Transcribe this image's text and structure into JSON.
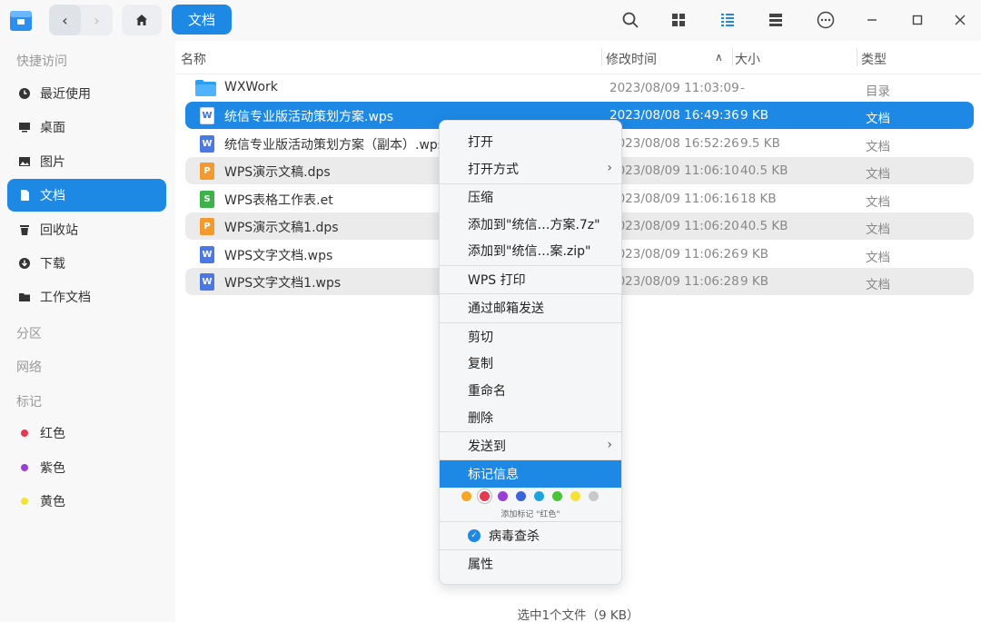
{
  "titlebar": {
    "breadcrumb": "文档",
    "icons": [
      "search-icon",
      "icon-view-icon",
      "list-view-icon",
      "detail-view-icon",
      "more-menu-icon",
      "minimize-icon",
      "maximize-icon",
      "close-icon"
    ]
  },
  "sidebar": {
    "quick_access_label": "快捷访问",
    "items": [
      {
        "label": "最近使用",
        "icon": "clock-icon"
      },
      {
        "label": "桌面",
        "icon": "desktop-icon"
      },
      {
        "label": "图片",
        "icon": "image-icon"
      },
      {
        "label": "文档",
        "icon": "document-icon"
      },
      {
        "label": "回收站",
        "icon": "trash-icon"
      },
      {
        "label": "下载",
        "icon": "download-icon"
      },
      {
        "label": "工作文档",
        "icon": "folder-icon"
      }
    ],
    "partition_label": "分区",
    "network_label": "网络",
    "tags_label": "标记",
    "tags": [
      {
        "label": "红色",
        "color": "#e53950"
      },
      {
        "label": "紫色",
        "color": "#9a3fd6"
      },
      {
        "label": "黄色",
        "color": "#f4e23a"
      }
    ]
  },
  "columns": {
    "name": "名称",
    "mtime": "修改时间",
    "size": "大小",
    "type": "类型"
  },
  "files": [
    {
      "name": "WXWork",
      "mtime": "2023/08/09 11:03:09",
      "size": "-",
      "type": "目录",
      "kind": "folder"
    },
    {
      "name": "统信专业版活动策划方案.wps",
      "mtime": "2023/08/08 16:49:36",
      "size": "9 KB",
      "type": "文档",
      "kind": "wps"
    },
    {
      "name": "统信专业版活动策划方案（副本）.wps",
      "mtime": "2023/08/08 16:52:26",
      "size": "9.5 KB",
      "type": "文档",
      "kind": "wps"
    },
    {
      "name": "WPS演示文稿.dps",
      "mtime": "2023/08/09 11:06:10",
      "size": "40.5 KB",
      "type": "文档",
      "kind": "dps"
    },
    {
      "name": "WPS表格工作表.et",
      "mtime": "2023/08/09 11:06:16",
      "size": "18 KB",
      "type": "文档",
      "kind": "et"
    },
    {
      "name": "WPS演示文稿1.dps",
      "mtime": "2023/08/09 11:06:20",
      "size": "40.5 KB",
      "type": "文档",
      "kind": "dps"
    },
    {
      "name": "WPS文字文档.wps",
      "mtime": "2023/08/09 11:06:26",
      "size": "9 KB",
      "type": "文档",
      "kind": "wps"
    },
    {
      "name": "WPS文字文档1.wps",
      "mtime": "2023/08/09 11:06:28",
      "size": "9 KB",
      "type": "文档",
      "kind": "wps"
    }
  ],
  "file_icon_letters": {
    "wps": "W",
    "dps": "P",
    "et": "S"
  },
  "status": "选中1个文件（9 KB）",
  "context_menu": {
    "open": "打开",
    "open_with": "打开方式",
    "compress": "压缩",
    "add_7z": "添加到\"统信…方案.7z\"",
    "add_zip": "添加到\"统信…案.zip\"",
    "wps_print": "WPS 打印",
    "email_send": "通过邮箱发送",
    "cut": "剪切",
    "copy": "复制",
    "rename": "重命名",
    "delete": "删除",
    "send_to": "发送到",
    "tag_info": "标记信息",
    "tag_colors": [
      "#f5a623",
      "#e53950",
      "#9a3fd6",
      "#3b64d8",
      "#1fa2e0",
      "#4cc43a",
      "#f4e23a",
      "#c8c8c8"
    ],
    "tag_hint": "添加标记 \"红色\"",
    "virus_scan": "病毒查杀",
    "properties": "属性"
  }
}
